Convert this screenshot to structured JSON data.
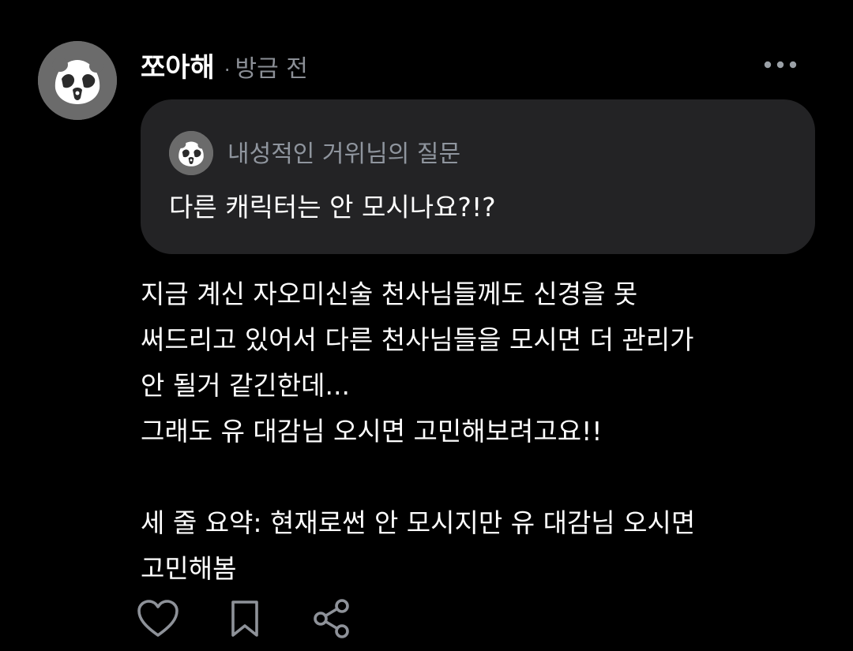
{
  "post": {
    "author": {
      "username": "쪼아해",
      "avatar_icon": "panda-icon",
      "avatar_bg": "#6b6b6b"
    },
    "separator": "·",
    "timestamp": "방금 전",
    "more_icon": "more-horizontal-icon",
    "quote": {
      "avatar_icon": "panda-icon",
      "title": "내성적인 거위님의 질문",
      "question": "다른 캐릭터는 안 모시나요?!?"
    },
    "body_lines": [
      "지금 계신 자오미신술 천사님들께도 신경을 못",
      "써드리고 있어서 다른 천사님들을 모시면 더 관리가",
      "안 될거 같긴한데...",
      "그래도 유 대감님 오시면 고민해보려고요!!",
      "",
      "세 줄 요약: 현재로썬 안 모시지만 유 대감님 오시면",
      "고민해봄"
    ],
    "actions": [
      {
        "icon": "heart-icon"
      },
      {
        "icon": "bookmark-icon"
      },
      {
        "icon": "share-icon"
      }
    ]
  },
  "colors": {
    "background": "#000000",
    "card": "#232325",
    "muted_text": "#8b8f96",
    "text": "#ffffff"
  }
}
